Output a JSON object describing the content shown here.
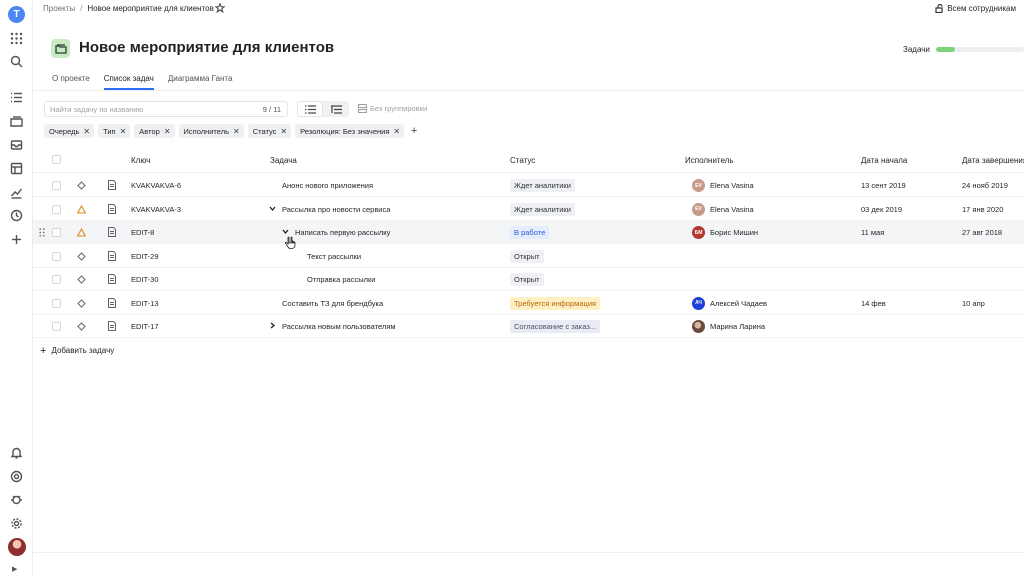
{
  "sidebar": {
    "logo_letter": "T",
    "icons": [
      "apps-icon",
      "search-icon",
      "tasks-icon",
      "projects-icon",
      "inbox-icon",
      "dashboard-icon",
      "stats-icon",
      "history-icon",
      "add-icon",
      "notifications-icon",
      "help-icon",
      "bug-icon",
      "settings-icon"
    ]
  },
  "breadcrumbs": {
    "root": "Проекты",
    "separator": "/",
    "current": "Новое мероприятие для клиентов"
  },
  "share": {
    "label": "Всем сотрудникам"
  },
  "header": {
    "title": "Новое мероприятие для клиентов",
    "progress_label": "Задачи",
    "progress_value": 0.22
  },
  "tabs": [
    {
      "label": "О проекте",
      "active": false
    },
    {
      "label": "Список задач",
      "active": true
    },
    {
      "label": "Диаграмма Ганта",
      "active": false
    }
  ],
  "toolbar": {
    "search_placeholder": "Найти задачу по названию",
    "search_count": "9 / 11",
    "grouping_label": "Без группировки"
  },
  "filters": [
    "Очередь",
    "Тип",
    "Автор",
    "Исполнитель",
    "Статус",
    "Резолюция: Без значения"
  ],
  "columns": {
    "key": "Ключ",
    "task": "Задача",
    "status": "Статус",
    "assignee": "Исполнитель",
    "start": "Дата начала",
    "end": "Дата завершения"
  },
  "rows": [
    {
      "key": "KVAKVAKVA-6",
      "task": "Анонс нового приложения",
      "status": "Ждет аналитики",
      "assignee": "Elena Vasina",
      "avatar": "EV",
      "start": "13 сент 2019",
      "end": "24 нояб 2019",
      "priority": "normal"
    },
    {
      "key": "KVAKVAKVA-3",
      "task": "Рассылка про новости сервиса",
      "status": "Ждет аналитики",
      "assignee": "Elena Vasina",
      "avatar": "EV",
      "start": "03 дек 2019",
      "end": "17 янв 2020",
      "priority": "high"
    },
    {
      "key": "EDIT-8",
      "task": "Написать первую рассылку",
      "status": "В работе",
      "assignee": "Борис Мишин",
      "avatar": "БМ",
      "start": "11 мая",
      "end": "27 авг 2018",
      "priority": "high"
    },
    {
      "key": "EDIT-29",
      "task": "Текст рассылки",
      "status": "Открыт",
      "assignee": "",
      "avatar": "",
      "start": "",
      "end": "",
      "priority": "normal"
    },
    {
      "key": "EDIT-30",
      "task": "Отправка рассылки",
      "status": "Открыт",
      "assignee": "",
      "avatar": "",
      "start": "",
      "end": "",
      "priority": "normal"
    },
    {
      "key": "EDIT-13",
      "task": "Составить ТЗ для брендбука",
      "status": "Требуется информация",
      "assignee": "Алексей Чадаев",
      "avatar": "АЧ",
      "start": "14 фев",
      "end": "10 апр",
      "priority": "normal"
    },
    {
      "key": "EDIT-17",
      "task": "Рассылка новым пользователям",
      "status": "Согласование с заказ...",
      "assignee": "Марина Ларина",
      "avatar": "",
      "start": "",
      "end": "",
      "priority": "normal"
    }
  ],
  "add_task_label": "Добавить задачу",
  "colors": {
    "accent": "#2a6df4",
    "progress": "#7ed37a",
    "priority_high": "#e08a1e"
  }
}
